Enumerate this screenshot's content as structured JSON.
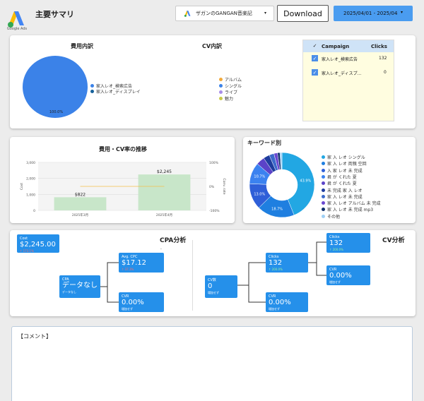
{
  "header": {
    "logo_label": "Google Ads",
    "title": "主要サマリ",
    "account": "ザガンのGANGAN音楽記",
    "download_label": "Download",
    "date_range": "2025/04/01 - 2025/04"
  },
  "cost_breakdown": {
    "title": "費用内訳",
    "pie_label": "100.0%",
    "legend": [
      "家入レオ_検索広告",
      "家入レオ_ディスプレイ"
    ],
    "colors": [
      "#3b82e8",
      "#16619a"
    ]
  },
  "cv_breakdown": {
    "title": "CV内訳",
    "legend": [
      "アルバム",
      "シングル",
      "ライブ",
      "魅力"
    ],
    "colors": [
      "#f2a93b",
      "#3b82e8",
      "#a88ce8",
      "#c9c94a"
    ]
  },
  "campaign_table": {
    "col_campaign": "Campaign",
    "col_clicks": "Clicks",
    "check_glyph": "✓",
    "rows": [
      {
        "name": "家入レオ_検索広告",
        "clicks": "132"
      },
      {
        "name": "家入レオ_ディスプ...",
        "clicks": "0"
      }
    ]
  },
  "trend": {
    "title": "費用・CV率の推移",
    "y_left_label": "Cost",
    "y_right_label": "Conv. rate",
    "y_left_ticks": [
      "3,000",
      "2,000",
      "1,000",
      "0"
    ],
    "y_right_ticks": [
      "100%",
      "0%",
      "-100%"
    ],
    "chart_data": {
      "type": "bar",
      "categories": [
        "2025年3月",
        "2025年4月"
      ],
      "series": [
        {
          "name": "Cost",
          "values": [
            822,
            2245
          ],
          "labels": [
            "$822",
            "$2,245"
          ]
        },
        {
          "name": "Conv. rate",
          "values": [
            0,
            0
          ]
        }
      ],
      "ylim": [
        0,
        3000
      ]
    }
  },
  "keywords": {
    "title": "キーワード別",
    "chart_data": {
      "type": "pie",
      "labels": [
        "家 入 レオ シングル",
        "家 入 レオ 両親 空回",
        "入 家 レオ 未 完成",
        "君 が くれた 夏",
        "君 が くれた 夏",
        "未 完成 家 入 レオ",
        "家 入 レオ 未 完成",
        "家 入 レオ アルバム 未 完成",
        "家 入 レオ 未 完成 mp3",
        "その他"
      ],
      "values": [
        43.9,
        18.7,
        13.0,
        10.7,
        4.2,
        3.1,
        2.4,
        1.8,
        1.2,
        1.0
      ],
      "slice_labels": [
        "43.9%",
        "18.7%",
        "13.0%",
        "10.7%"
      ],
      "colors": [
        "#22a7e3",
        "#1f7fe0",
        "#2f5fd8",
        "#3b82f0",
        "#5b43c8",
        "#1e3c9e",
        "#3d6acb",
        "#6a48d0",
        "#0d2f6b",
        "#9fd0f5"
      ]
    }
  },
  "cpa": {
    "title": "CPA分析",
    "cost": {
      "label": "Cost",
      "value": "$2,245.00",
      "sub": "↑ 173.1%"
    },
    "cpa": {
      "label": "CPA",
      "value": "データなし",
      "sub": "データなし"
    },
    "avg_cpc": {
      "label": "Avg. CPC",
      "value": "$17.12",
      "sub": "↑ 37.3%"
    },
    "cvr": {
      "label": "CVR",
      "value": "0.00%",
      "sub": "増加せず"
    },
    "dot": "·"
  },
  "cv": {
    "title": "CV分析",
    "cv_count": {
      "label": "CV数",
      "value": "0",
      "sub": "増加せず"
    },
    "clicks_mid": {
      "label": "Clicks",
      "value": "132",
      "sub": "↑ 200.0%"
    },
    "cvr_mid": {
      "label": "CVR",
      "value": "0.00%",
      "sub": "増加せず"
    },
    "clicks_top": {
      "label": "Clicks",
      "value": "132",
      "sub": "↑ 200.0%"
    },
    "cvr_right": {
      "label": "CVR",
      "value": "0.00%",
      "sub": "増加せず"
    }
  },
  "comment": {
    "label": "【コメント】"
  }
}
